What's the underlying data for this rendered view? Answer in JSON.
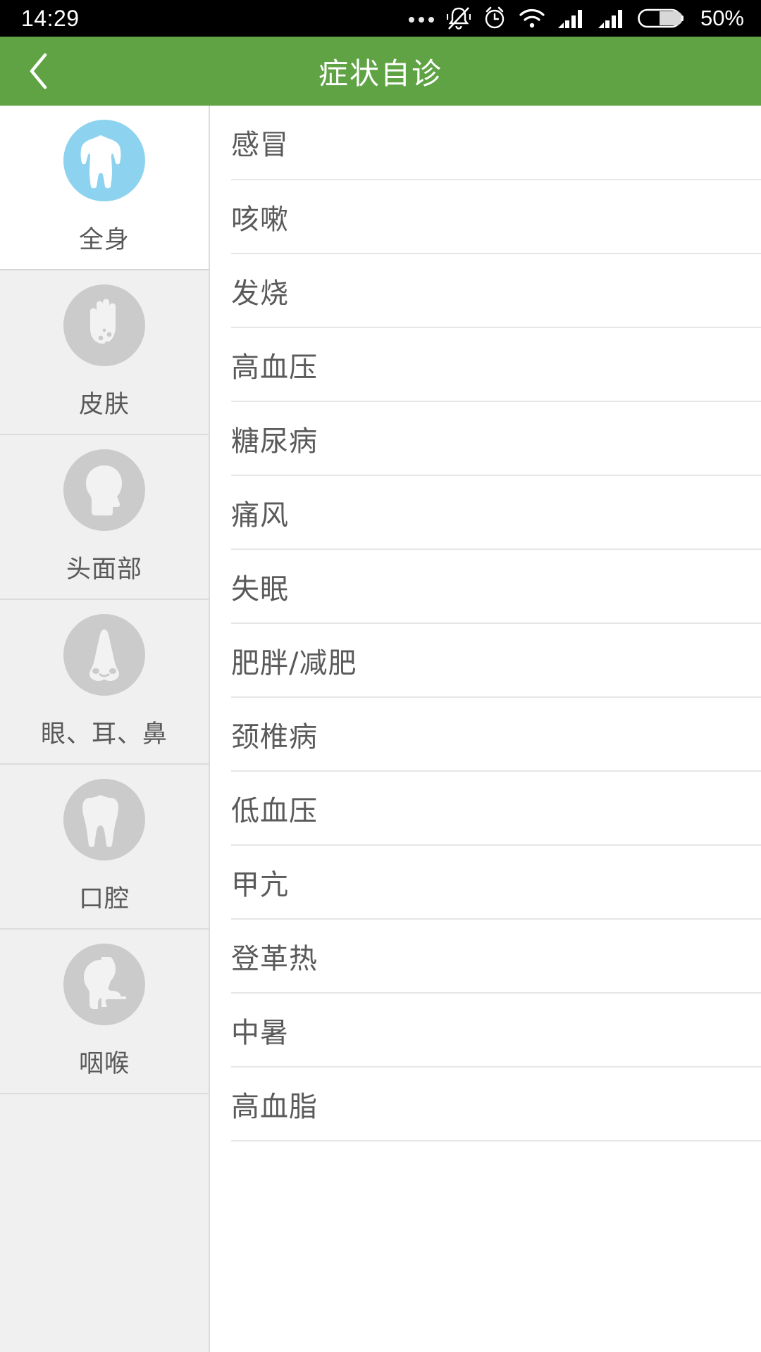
{
  "status_bar": {
    "time": "14:29",
    "battery_percent": "50%",
    "icons": [
      "more-dots-icon",
      "bell-muted-icon",
      "alarm-clock-icon",
      "wifi-icon",
      "signal-bars-icon",
      "signal-bars-icon",
      "battery-icon"
    ]
  },
  "app_bar": {
    "back_icon": "chevron-left-icon",
    "title": "症状自诊",
    "background_color": "#60a344"
  },
  "sidebar": {
    "active_index": 0,
    "active_icon_color": "#8dd3ef",
    "inactive_icon_color": "#cbcbcb",
    "items": [
      {
        "label": "全身",
        "icon": "torso-body-icon"
      },
      {
        "label": "皮肤",
        "icon": "hand-rash-icon"
      },
      {
        "label": "头面部",
        "icon": "head-profile-icon"
      },
      {
        "label": "眼、耳、鼻",
        "icon": "nose-icon"
      },
      {
        "label": "口腔",
        "icon": "tooth-icon"
      },
      {
        "label": "咽喉",
        "icon": "throat-head-icon"
      }
    ]
  },
  "list": {
    "items": [
      {
        "label": "感冒"
      },
      {
        "label": "咳嗽"
      },
      {
        "label": "发烧"
      },
      {
        "label": "高血压"
      },
      {
        "label": "糖尿病"
      },
      {
        "label": "痛风"
      },
      {
        "label": "失眠"
      },
      {
        "label": "肥胖/减肥"
      },
      {
        "label": "颈椎病"
      },
      {
        "label": "低血压"
      },
      {
        "label": "甲亢"
      },
      {
        "label": "登革热"
      },
      {
        "label": "中暑"
      },
      {
        "label": "高血脂"
      }
    ]
  }
}
